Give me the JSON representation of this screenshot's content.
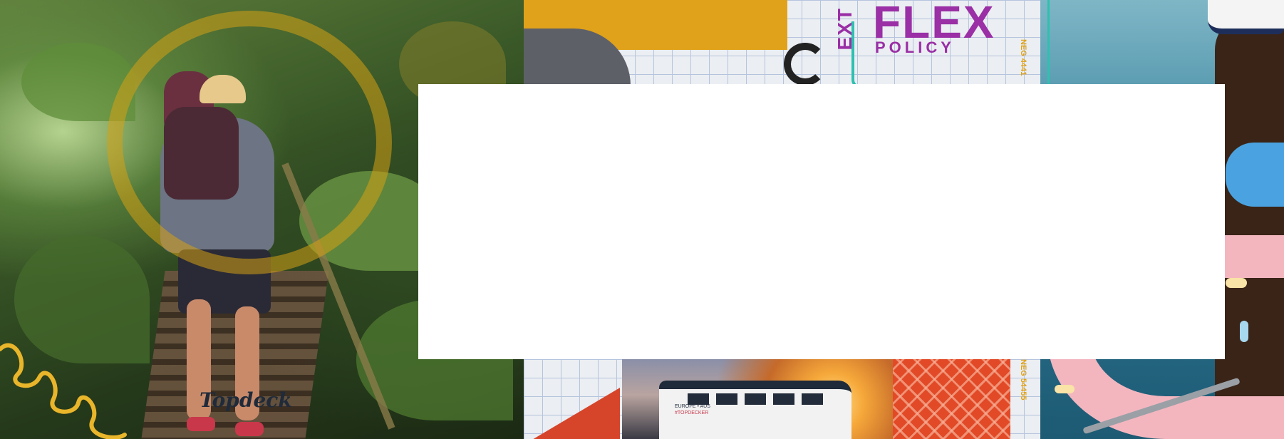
{
  "poster": {
    "flex_title": "FLEX",
    "ext_label": "EXT",
    "policy_label": "POLICY",
    "neg_top": "NEG 4441",
    "neg_bottom": "NEG 54455"
  },
  "bus": {
    "brand": "Topdeck",
    "small_line": "EUROPE • AUS",
    "hashtag": "#TOPDECKER"
  },
  "modal": {
    "title": ""
  },
  "colors": {
    "accent_purple": "#9a2fa6",
    "accent_yellow": "#e0a21a",
    "accent_teal": "#2fc0b0",
    "accent_orange": "#e24a27"
  },
  "icons": [
    "yellow-ring-graphic",
    "yellow-spiral-graphic"
  ]
}
